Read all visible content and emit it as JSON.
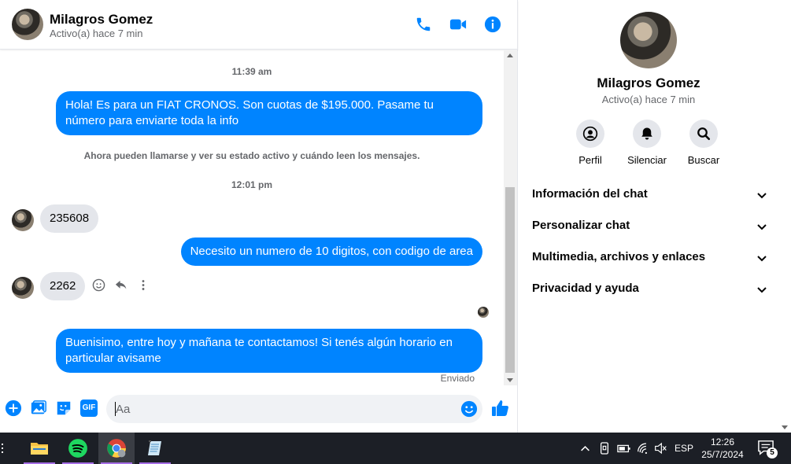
{
  "contact": {
    "name": "Milagros Gomez",
    "status": "Activo(a) hace 7 min"
  },
  "header": {
    "icons": [
      "phone-icon",
      "video-call-icon",
      "info-icon"
    ],
    "accent": "#0084ff"
  },
  "messages": {
    "time_1": "11:39 am",
    "msg_1": "Hola! Es para un FIAT CRONOS. Son cuotas de $195.000. Pasame tu número para enviarte toda la info",
    "notice": "Ahora pueden llamarse y ver su estado activo y cuándo leen los mensajes.",
    "time_2": "12:01 pm",
    "msg_2": "235608",
    "msg_3": "Necesito un numero de 10 digitos, con codigo de area",
    "msg_4": "2262",
    "msg_5": "Buenisimo, entre hoy y mañana te contactamos! Si tenés algún horario en particular avisame",
    "sent_label": "Enviado"
  },
  "composer": {
    "placeholder": "Aa",
    "gif_label": "GIF"
  },
  "info_panel": {
    "actions": [
      {
        "label": "Perfil",
        "icon": "profile-icon"
      },
      {
        "label": "Silenciar",
        "icon": "bell-icon"
      },
      {
        "label": "Buscar",
        "icon": "search-icon"
      }
    ],
    "sections": [
      "Información del chat",
      "Personalizar chat",
      "Multimedia, archivos y enlaces",
      "Privacidad y ayuda"
    ]
  },
  "taskbar": {
    "apps": [
      "file-explorer-icon",
      "spotify-icon",
      "chrome-icon",
      "notepad-icon"
    ],
    "lang": "ESP",
    "time": "12:26",
    "date": "25/7/2024",
    "notifications": "5"
  }
}
